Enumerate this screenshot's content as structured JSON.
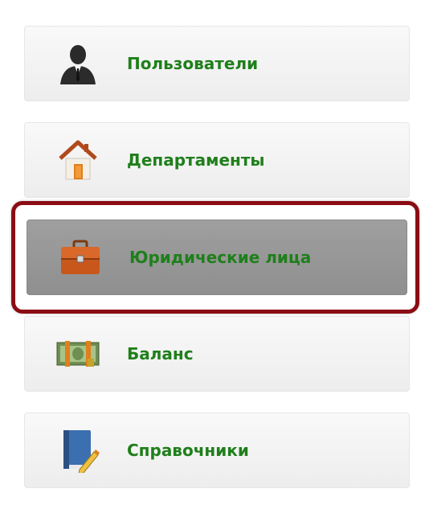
{
  "menu": {
    "items": [
      {
        "label": "Пользователи",
        "icon": "user-icon"
      },
      {
        "label": "Департаменты",
        "icon": "house-icon"
      },
      {
        "label": "Юридические лица",
        "icon": "briefcase-icon",
        "active": true
      },
      {
        "label": "Баланс",
        "icon": "money-icon"
      },
      {
        "label": "Справочники",
        "icon": "book-icon"
      }
    ]
  },
  "colors": {
    "label": "#1f7f1b",
    "highlight_border": "#8b0c14",
    "active_bg": "#9a9a9a"
  }
}
